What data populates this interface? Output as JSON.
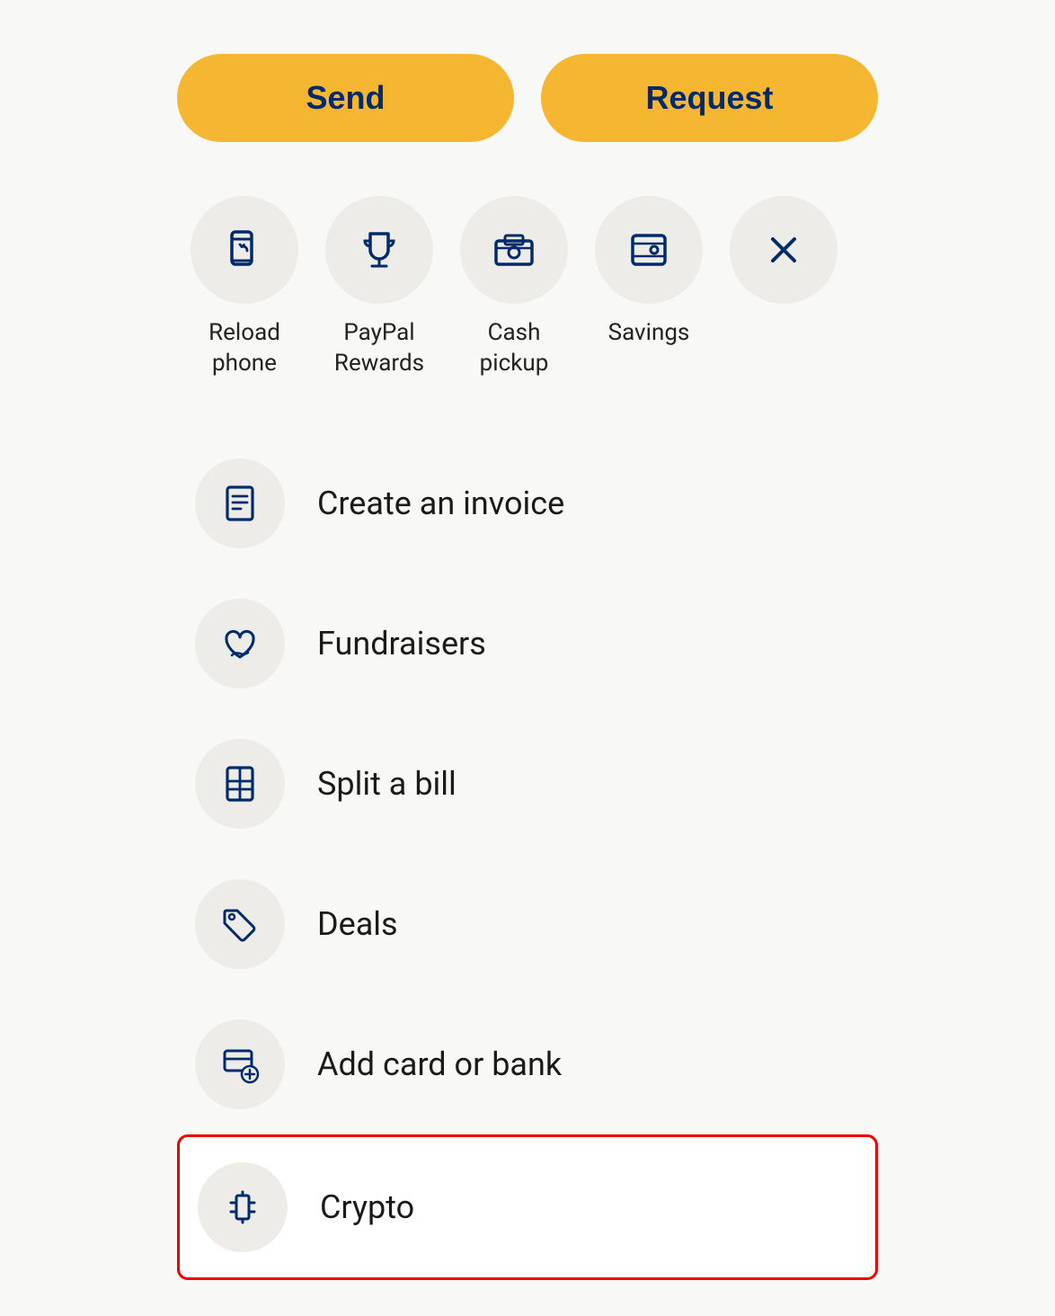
{
  "buttons": {
    "send": "Send",
    "request": "Request"
  },
  "quickActions": [
    {
      "id": "reload-phone",
      "label": "Reload\nphone",
      "icon": "reload-phone"
    },
    {
      "id": "paypal-rewards",
      "label": "PayPal\nRewards",
      "icon": "trophy"
    },
    {
      "id": "cash-pickup",
      "label": "Cash\npickup",
      "icon": "cash-pickup"
    },
    {
      "id": "savings",
      "label": "Savings",
      "icon": "savings"
    },
    {
      "id": "close",
      "label": "",
      "icon": "close"
    }
  ],
  "listItems": [
    {
      "id": "create-invoice",
      "label": "Create an invoice",
      "icon": "invoice"
    },
    {
      "id": "fundraisers",
      "label": "Fundraisers",
      "icon": "fundraisers"
    },
    {
      "id": "split-bill",
      "label": "Split a bill",
      "icon": "split-bill"
    },
    {
      "id": "deals",
      "label": "Deals",
      "icon": "deals"
    },
    {
      "id": "add-card-or-bank",
      "label": "Add card or bank",
      "icon": "add-card"
    },
    {
      "id": "crypto",
      "label": "Crypto",
      "icon": "crypto",
      "highlighted": true
    }
  ]
}
